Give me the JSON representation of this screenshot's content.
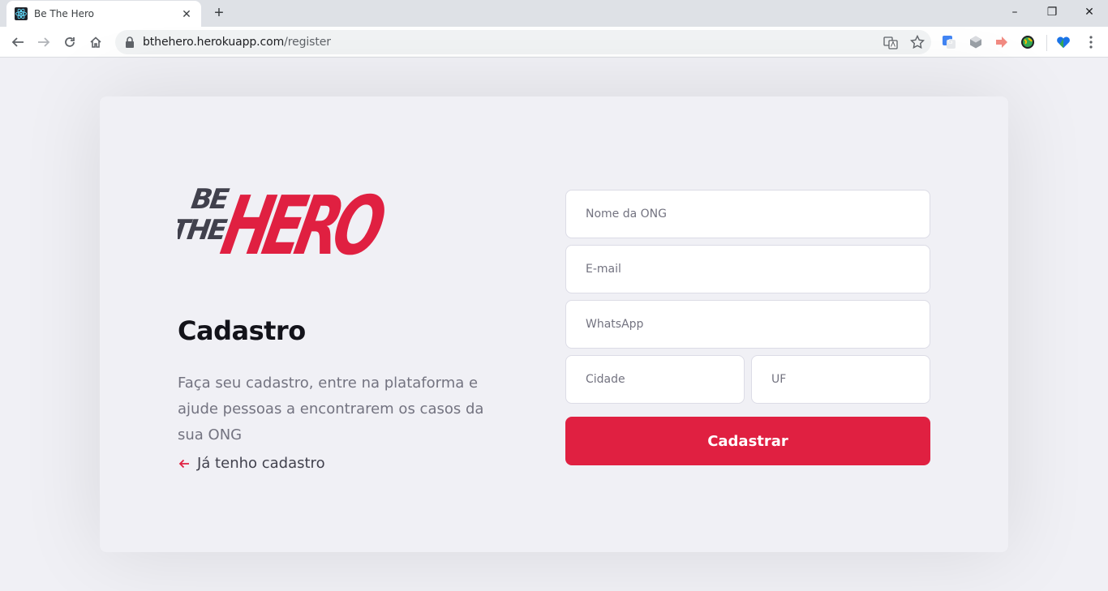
{
  "browser": {
    "tab_title": "Be The Hero",
    "new_tab": "+",
    "url_host": "bthehero.herokuapp.com",
    "url_path": "/register",
    "win_minimize": "–",
    "win_restore": "❐",
    "win_close": "✕"
  },
  "logo": {
    "line1": "BE",
    "line2": "THE",
    "word": "HERO",
    "color": "#e02041",
    "dark": "#41414d"
  },
  "page": {
    "title": "Cadastro",
    "description": "Faça seu cadastro, entre na plataforma e ajude pessoas a encontrarem os casos da sua ONG",
    "back_link": "Já tenho cadastro"
  },
  "form": {
    "name_placeholder": "Nome da ONG",
    "email_placeholder": "E-mail",
    "whatsapp_placeholder": "WhatsApp",
    "city_placeholder": "Cidade",
    "uf_placeholder": "UF",
    "submit_label": "Cadastrar"
  },
  "colors": {
    "accent": "#e02041",
    "background": "#f0f0f5",
    "text_dark": "#13131a",
    "text_muted": "#737380"
  }
}
